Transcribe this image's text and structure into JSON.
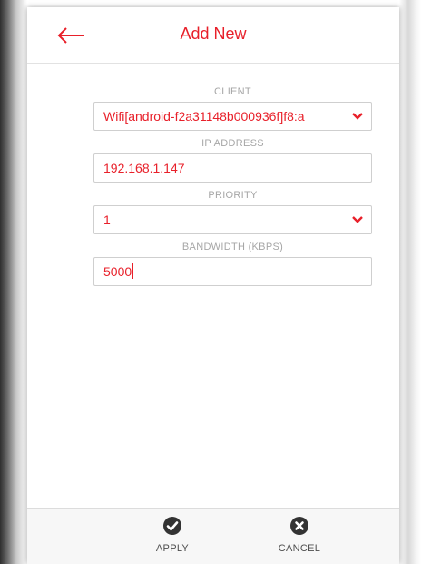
{
  "header": {
    "title": "Add New",
    "back_icon": "arrow-left-icon"
  },
  "form": {
    "client": {
      "label": "CLIENT",
      "value": "Wifi[android-f2a31148b000936f]f8:a"
    },
    "ip_address": {
      "label": "IP ADDRESS",
      "value": "192.168.1.147"
    },
    "priority": {
      "label": "PRIORITY",
      "value": "1"
    },
    "bandwidth": {
      "label": "BANDWIDTH (KBPS)",
      "value": "5000"
    }
  },
  "footer": {
    "apply_label": "APPLY",
    "cancel_label": "CANCEL",
    "apply_icon": "check-circle-icon",
    "cancel_icon": "x-circle-icon"
  },
  "colors": {
    "accent": "#e8202a",
    "label_gray": "#a6a6a6",
    "footer_icon": "#333333"
  }
}
